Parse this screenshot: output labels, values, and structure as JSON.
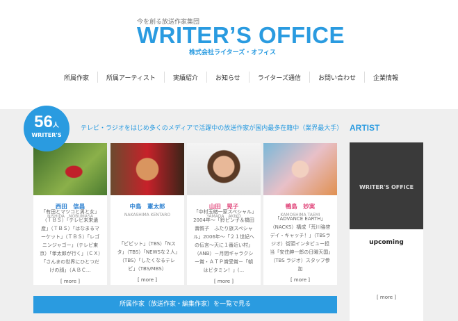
{
  "header": {
    "tagline": "今を創る放送作家集団",
    "logo": "WRITER’S OFFICE",
    "company": "株式会社ライターズ・オフィス"
  },
  "nav": [
    "所属作家",
    "所属アーティスト",
    "実績紹介",
    "お知らせ",
    "ライターズ通信",
    "お問い合わせ",
    "企業情報"
  ],
  "badge": {
    "number": "56",
    "unit": "人",
    "label": "WRITER'S"
  },
  "intro": "テレビ・ラジオをはじめ多くのメディアで活躍中の放送作家が国内最多在籍中（業界最大手）",
  "writers": [
    {
      "name": "西田　信昌",
      "roman": "NISHIDA　NOBUMASA",
      "desc": "「有田とマツコと男と女」（ＴＢＳ）「テレビ未来遺産」（ＴＢＳ）「はなまるマーケット」（ＴＢＳ）「レゴニンジャゴー」（テレビ東京）「孝太郎が行く」（ＣＸ）「さんまの世界にひとつだけの顔」（ＡＢＣ...",
      "more": "[ more ]",
      "color": "#2a7fd0"
    },
    {
      "name": "中島　憲太郎",
      "roman": "NAKASHIMA KENTARO",
      "desc": "「ビビット」（TBS）「Nスタ」（TBS）「NEWSな２人」（TBS）「したくなるテレビ」（TBS/MBS）",
      "more": "[ more ]",
      "color": "#2a7fd0"
    },
    {
      "name": "山田　晃子",
      "roman": "YAMADA　AKIKO",
      "desc": "「中村玉緒一家スペシャル」2004年～「鈴ピン子＆橋田壽賀子　ふたり旅スペシャル」2006年～「２１世紀への伝言～天に１番近い村」（ANB）－月間ギャラクシー賞・ＡＴＰ賞受賞－「朝はビタミン！」(...",
      "more": "[ more ]",
      "color": "#e0457a"
    },
    {
      "name": "鴨島　妙実",
      "roman": "KAMOSHIMA TAEMI",
      "desc": "「ADVANCE EARTH」（NACKS）構成「荒川強啓デイ・キャッチ！」（TBSラジオ）街頭インタビュー担当「安住紳一郎の日曜天国」（TBS ラジオ）スタッフ参加",
      "more": "[ more ]",
      "color": "#e0457a"
    }
  ],
  "list_button": "所属作家（放送作家・編集作家）を一覧で見る",
  "sidebar": {
    "heading": "ARTIST",
    "image_text": "WRITER'S OFFICE",
    "title": "upcoming",
    "more": "[ more ]"
  }
}
